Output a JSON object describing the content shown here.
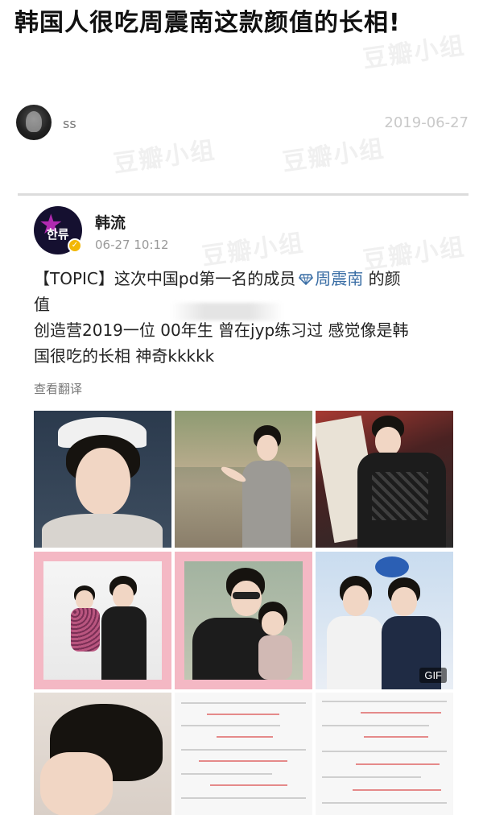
{
  "article": {
    "title": "韩国人很吃周震南这款颜值的长相!",
    "author": "ss",
    "date": "2019-06-27"
  },
  "watermark": "豆瓣小组",
  "weibo_post": {
    "account_name": "韩流",
    "avatar_text": "한류",
    "timestamp": "06-27 10:12",
    "text_line1_prefix": "【TOPIC】这次中国pd第一名的成员",
    "topic_name": "周震南",
    "text_line1_suffix": " 的颜",
    "text_line2": "值",
    "text_line3": "创造营2019一位 00年生 曾在jyp练习过 感觉像是韩",
    "text_line4": "国很吃的长相 神奇kkkkk",
    "translate_label": "查看翻译"
  },
  "photos": {
    "gif_label": "GIF"
  },
  "colors": {
    "link": "#3a6ea5",
    "date": "#c9c9c9",
    "divider": "#dcdcdc",
    "badge": "#f2b705"
  }
}
